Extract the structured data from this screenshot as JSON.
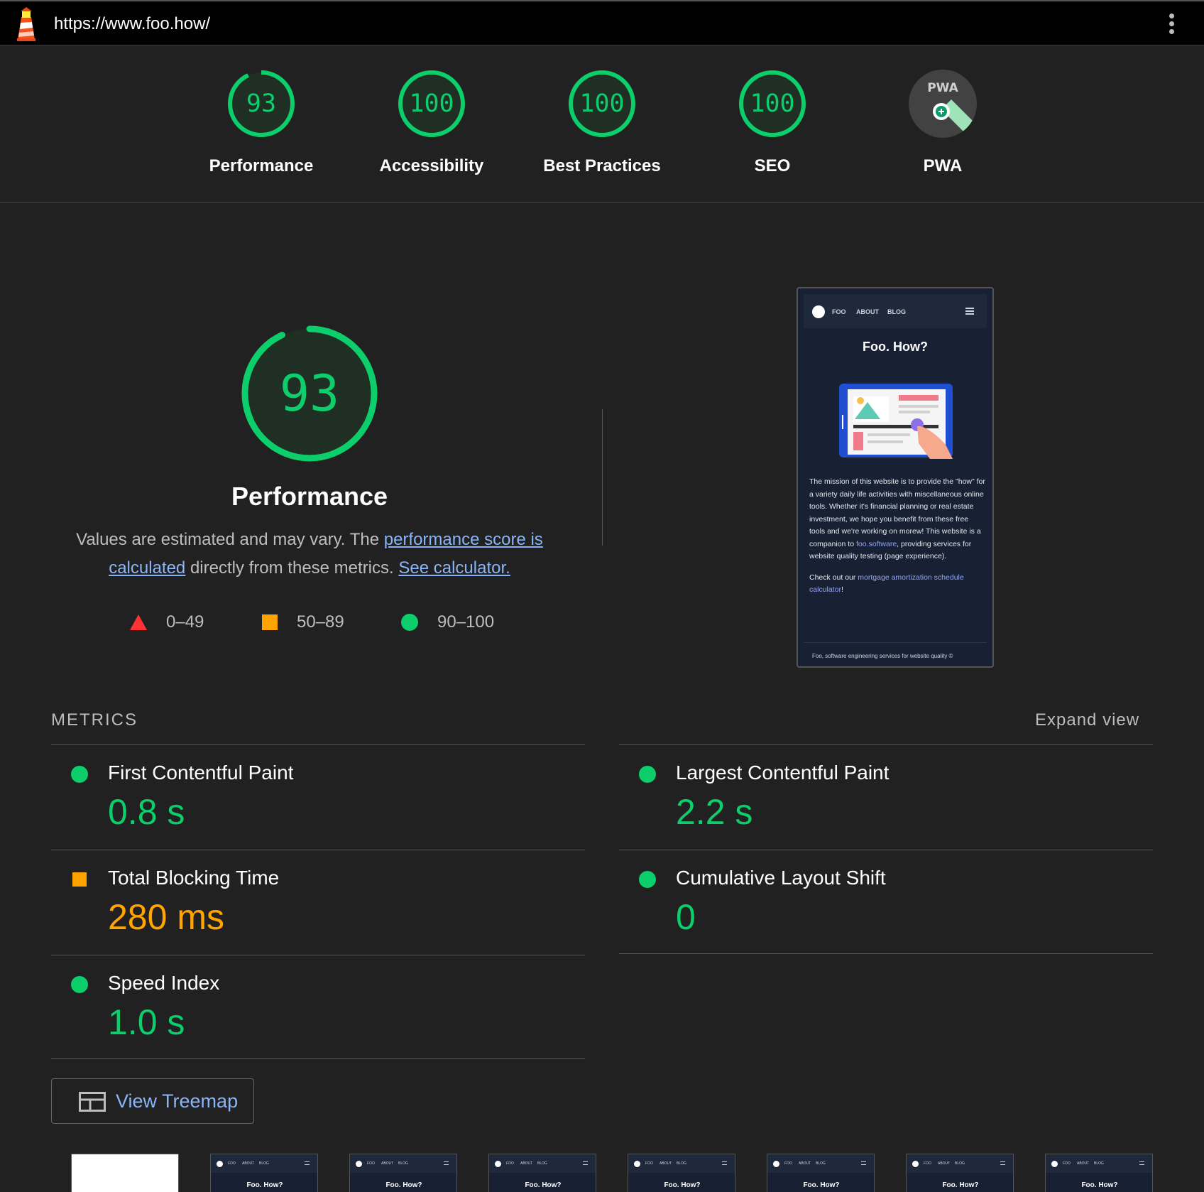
{
  "url": "https://www.foo.how/",
  "colors": {
    "pass": "#0cce6b",
    "average": "#ffa400",
    "fail": "#ff4e42",
    "link": "#8ab4f8",
    "background": "#212121"
  },
  "scores": [
    {
      "name": "Performance",
      "value": "93",
      "fraction": 0.93
    },
    {
      "name": "Accessibility",
      "value": "100",
      "fraction": 1.0
    },
    {
      "name": "Best Practices",
      "value": "100",
      "fraction": 1.0
    },
    {
      "name": "SEO",
      "value": "100",
      "fraction": 1.0
    },
    {
      "name": "PWA",
      "value": "",
      "badge": "PWA"
    }
  ],
  "performance": {
    "score": "93",
    "fraction": 0.93,
    "title": "Performance",
    "desc_prefix": "Values are estimated and may vary. The ",
    "desc_link1": "performance score is calculated",
    "desc_middle": " directly from these metrics. ",
    "desc_link2": "See calculator."
  },
  "legend": [
    {
      "shape": "triangle",
      "range": "0–49"
    },
    {
      "shape": "square",
      "range": "50–89"
    },
    {
      "shape": "circle",
      "range": "90–100"
    }
  ],
  "screenshot": {
    "nav": [
      "FOO",
      "ABOUT",
      "BLOG"
    ],
    "title": "Foo. How?",
    "body1_a": "The mission of this website is to provide the \"how\" for a variety daily life activities with miscellaneous online tools. Whether it's financial planning or real estate investment, we hope you benefit from these free tools and we're working on morew! This website is a companion to ",
    "body1_link": "foo.software",
    "body1_b": ", providing services for website quality testing (page experience).",
    "body2_a": "Check out our ",
    "body2_link": "mortgage amortization schedule calculator",
    "body2_b": "!",
    "footer": "Foo, software engineering services for website quality ©"
  },
  "metrics": {
    "heading": "METRICS",
    "expand": "Expand view",
    "items": [
      {
        "name": "First Contentful Paint",
        "value": "0.8 s",
        "rating": "pass"
      },
      {
        "name": "Largest Contentful Paint",
        "value": "2.2 s",
        "rating": "pass"
      },
      {
        "name": "Total Blocking Time",
        "value": "280 ms",
        "rating": "average"
      },
      {
        "name": "Cumulative Layout Shift",
        "value": "0",
        "rating": "pass"
      },
      {
        "name": "Speed Index",
        "value": "1.0 s",
        "rating": "pass"
      }
    ]
  },
  "treemap": {
    "label": "View Treemap"
  },
  "filmstrip": {
    "frame_title": "Foo. How?",
    "frame_nav": [
      "FOO",
      "ABOUT",
      "BLOG"
    ]
  }
}
